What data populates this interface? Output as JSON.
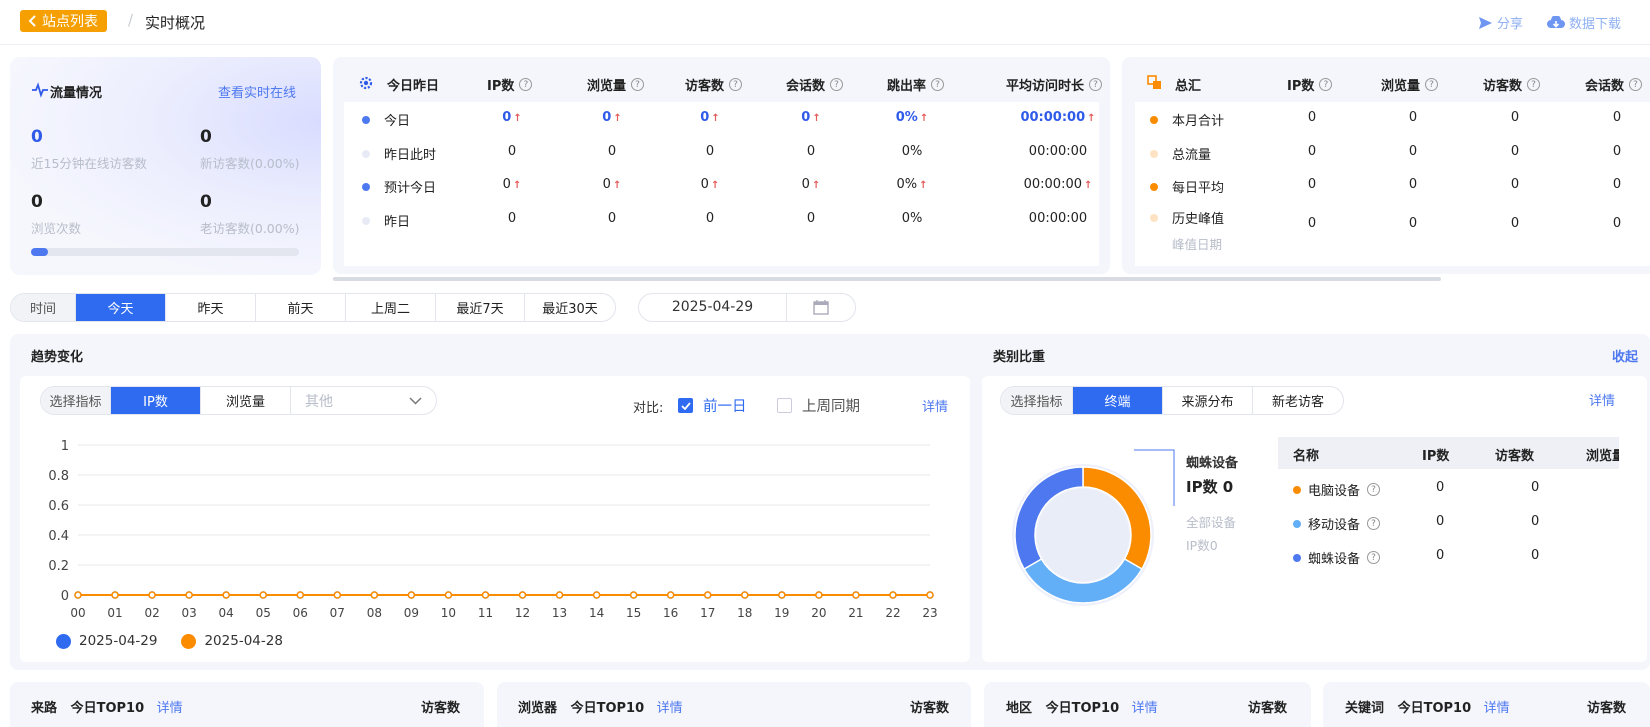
{
  "header": {
    "back_label": "站点列表",
    "breadcrumb_sep": "/",
    "page_title": "实时概况",
    "share_label": "分享",
    "download_label": "数据下载"
  },
  "traffic": {
    "title": "流量情况",
    "link": "查看实时在线",
    "online_value": "0",
    "online_label": "近15分钟在线访客数",
    "new_value": "0",
    "new_label": "新访客数(0.00%)",
    "pv_value": "0",
    "pv_label": "浏览次数",
    "old_value": "0",
    "old_label": "老访客数(0.00%)",
    "progress_fraction": 0.04,
    "accent": "#4d78f0"
  },
  "today_table": {
    "title": "今日昨日",
    "headers": [
      "IP数",
      "浏览量",
      "访客数",
      "会话数",
      "跳出率",
      "平均访问时长"
    ],
    "rows": [
      {
        "label": "今日",
        "values": [
          "0",
          "0",
          "0",
          "0",
          "0%",
          "00:00:00"
        ]
      },
      {
        "label": "昨日此时",
        "values": [
          "0",
          "0",
          "0",
          "0",
          "0%",
          "00:00:00"
        ]
      },
      {
        "label": "预计今日",
        "values": [
          "0",
          "0",
          "0",
          "0",
          "0%",
          "00:00:00"
        ]
      },
      {
        "label": "昨日",
        "values": [
          "0",
          "0",
          "0",
          "0",
          "0%",
          "00:00:00"
        ]
      }
    ]
  },
  "summary_table": {
    "title": "总汇",
    "headers": [
      "IP数",
      "浏览量",
      "访客数",
      "会话数"
    ],
    "rows": [
      {
        "label": "本月合计",
        "values": [
          "0",
          "0",
          "0",
          "0"
        ]
      },
      {
        "label": "总流量",
        "values": [
          "0",
          "0",
          "0",
          "0"
        ]
      },
      {
        "label": "每日平均",
        "values": [
          "0",
          "0",
          "0",
          "0"
        ]
      },
      {
        "label": "历史峰值",
        "sublabel": "峰值日期",
        "values": [
          "0",
          "0",
          "0",
          "0"
        ]
      }
    ]
  },
  "date_tabs": {
    "label": "时间",
    "tabs": [
      "今天",
      "昨天",
      "前天",
      "上周二",
      "最近7天",
      "最近30天"
    ],
    "active_index": 0,
    "date_value": "2025-04-29"
  },
  "trend": {
    "title": "趋势变化",
    "metric_label": "选择指标",
    "metrics": [
      "IP数",
      "浏览量"
    ],
    "other_placeholder": "其他",
    "compare_label": "对比:",
    "compare_prev_day": "前一日",
    "compare_last_week": "上周同期",
    "detail_link": "详情",
    "legend": [
      "2025-04-29",
      "2025-04-28"
    ]
  },
  "chart_data": {
    "type": "line",
    "x": [
      "00",
      "01",
      "02",
      "03",
      "04",
      "05",
      "06",
      "07",
      "08",
      "09",
      "10",
      "11",
      "12",
      "13",
      "14",
      "15",
      "16",
      "17",
      "18",
      "19",
      "20",
      "21",
      "22",
      "23"
    ],
    "y_ticks": [
      "0",
      "0.2",
      "0.4",
      "0.6",
      "0.8",
      "1"
    ],
    "ylim": [
      0,
      1
    ],
    "series": [
      {
        "name": "2025-04-29",
        "color": "#2f6bf0",
        "values": [
          0,
          0,
          0,
          0,
          0,
          0,
          0,
          0,
          0,
          0,
          0,
          0,
          0,
          0,
          0,
          0,
          0,
          0,
          0,
          0,
          0,
          0,
          0,
          0
        ]
      },
      {
        "name": "2025-04-28",
        "color": "#fb8c00",
        "values": [
          0,
          0,
          0,
          0,
          0,
          0,
          0,
          0,
          0,
          0,
          0,
          0,
          0,
          0,
          0,
          0,
          0,
          0,
          0,
          0,
          0,
          0,
          0,
          0
        ]
      }
    ],
    "grid": true,
    "legend_position": "bottom-left"
  },
  "category": {
    "title": "类别比重",
    "collapse_link": "收起",
    "metric_label": "选择指标",
    "tabs": [
      "终端",
      "来源分布",
      "新老访客"
    ],
    "detail_link": "详情",
    "callout_title": "蜘蛛设备",
    "callout_value": "IP数 0",
    "callout_sub1": "全部设备",
    "callout_sub2": "IP数0",
    "table_headers": [
      "名称",
      "IP数",
      "访客数",
      "浏览量"
    ],
    "rows": [
      {
        "name": "电脑设备",
        "color": "#fb8c00",
        "ip": "0",
        "visitors": "0"
      },
      {
        "name": "移动设备",
        "color": "#62aef7",
        "ip": "0",
        "visitors": "0"
      },
      {
        "name": "蜘蛛设备",
        "color": "#4d78f0",
        "ip": "0",
        "visitors": "0"
      }
    ],
    "donut_colors": [
      "#fb8c00",
      "#62aef7",
      "#4d78f0"
    ]
  },
  "bottom": [
    {
      "title": "来路",
      "sub": "今日TOP10",
      "link": "详情",
      "right": "访客数"
    },
    {
      "title": "浏览器",
      "sub": "今日TOP10",
      "link": "详情",
      "right": "访客数"
    },
    {
      "title": "地区",
      "sub": "今日TOP10",
      "link": "详情",
      "right": "访客数"
    },
    {
      "title": "关键词",
      "sub": "今日TOP10",
      "link": "详情",
      "right": "访客数"
    }
  ]
}
